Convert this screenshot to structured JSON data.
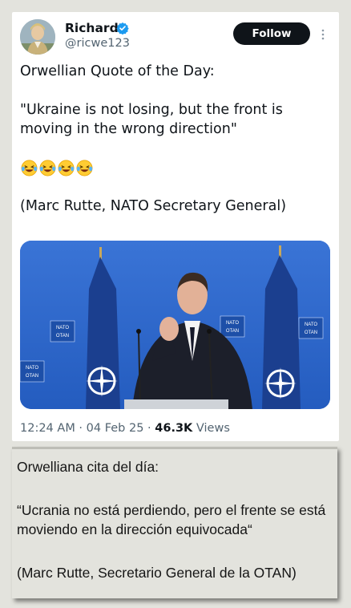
{
  "tweet": {
    "author": {
      "display_name": "Richard",
      "handle": "@ricwe123",
      "verified": true,
      "avatar_icon": "portrait-avatar"
    },
    "follow_label": "Follow",
    "more_icon": "more-vertical-icon",
    "text": {
      "line1": "Orwellian Quote of the Day:",
      "line2": "\"Ukraine is not losing, but the front is moving in the wrong direction\"",
      "emojis": [
        "😂",
        "😂",
        "😂",
        "😂"
      ],
      "line3": "(Marc Rutte, NATO Secretary General)"
    },
    "image": {
      "sign_text": "NATO",
      "sign_text_fr": "OTAN"
    },
    "meta": {
      "time": "12:24 AM",
      "sep1": " · ",
      "date": "04 Feb 25",
      "sep2": " · ",
      "views_count": "46.3K",
      "views_label": " Views"
    }
  },
  "translation": {
    "line1": "Orwelliana cita del día:",
    "line2": "“Ucrania no está perdiendo, pero el frente se está moviendo en la dirección equivocada“",
    "line3": "(Marc Rutte, Secretario General de la OTAN)"
  },
  "colors": {
    "page_bg": "#e3e3dd",
    "card_bg": "#ffffff",
    "follow_bg": "#0f1419",
    "verified_blue": "#1d9bf0",
    "muted_text": "#536471",
    "nato_blue": "#2f64c8"
  }
}
